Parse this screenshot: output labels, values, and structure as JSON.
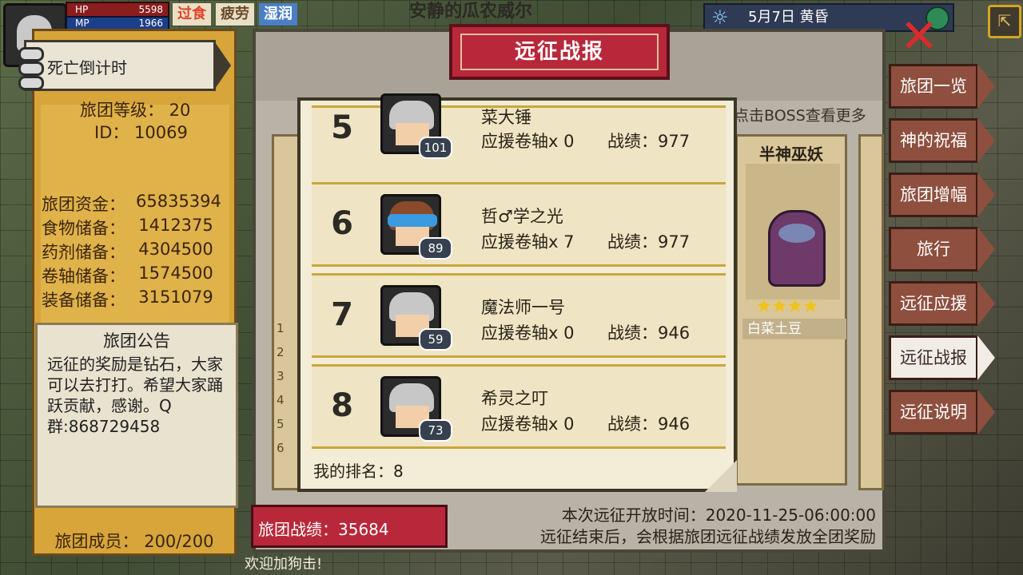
{
  "hud": {
    "hp_label": "HP",
    "hp_value": "5598",
    "mp_label": "MP",
    "mp_value": "1966",
    "status": [
      "过食",
      "疲劳",
      "湿润"
    ],
    "location": "安静的瓜农威尔",
    "date": "5月7日  黄昏"
  },
  "guild": {
    "countdown_label": "死亡倒计时",
    "level_line": "旅团等级： 20",
    "id_line": "ID： 10069",
    "stats": [
      {
        "label": "旅团资金：",
        "value": "65835394"
      },
      {
        "label": "食物储备：",
        "value": "1412375"
      },
      {
        "label": "药剂储备：",
        "value": "4304500"
      },
      {
        "label": "卷轴储备：",
        "value": "1574500"
      },
      {
        "label": "装备储备：",
        "value": "3151079"
      }
    ],
    "notice_title": "旅团公告",
    "notice_body": "远征的奖励是钻石，大家可以去打打。希望大家踊跃贡献，感谢。Q群:868729458",
    "members": "旅团成员： 200/200"
  },
  "report": {
    "title": "远征战报",
    "boss_hint": "点击BOSS查看更多",
    "boss_name": "半神巫妖",
    "boss_stars": "★★★★",
    "boss_tag": "白菜土豆",
    "left_ranks": [
      "1",
      "2",
      "3",
      "4",
      "5",
      "6"
    ],
    "rows": [
      {
        "rank": "5",
        "name": "菜大锤",
        "support": "应援卷轴x 0",
        "score": "战绩：977",
        "level": "101"
      },
      {
        "rank": "6",
        "name": "哲♂学之光",
        "support": "应援卷轴x 7",
        "score": "战绩：977",
        "level": "89"
      },
      {
        "rank": "7",
        "name": "魔法师一号",
        "support": "应援卷轴x 0",
        "score": "战绩：946",
        "level": "59"
      },
      {
        "rank": "8",
        "name": "希灵之叮",
        "support": "应援卷轴x 0",
        "score": "战绩：946",
        "level": "73"
      }
    ],
    "my_rank": "我的排名：8",
    "guild_score": "旅团战绩：35684",
    "open_time": "本次远征开放时间：2020-11-25-06:00:00",
    "reward_note": "远征结束后，会根据旅团远征战绩发放全团奖励",
    "bottom_caption": "欢迎加狗击!"
  },
  "side_menu": [
    {
      "label": "旅团一览",
      "active": false
    },
    {
      "label": "神的祝福",
      "active": false
    },
    {
      "label": "旅团增幅",
      "active": false
    },
    {
      "label": "旅行",
      "active": false
    },
    {
      "label": "远征应援",
      "active": false
    },
    {
      "label": "远征战报",
      "active": true
    },
    {
      "label": "远征说明",
      "active": false
    }
  ]
}
